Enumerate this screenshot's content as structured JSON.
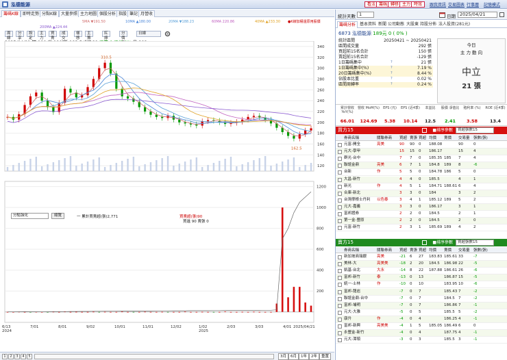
{
  "app": {
    "title": "泓德能源",
    "buttons": [
      "看法",
      "籌碼",
      "轉移",
      "主力",
      "時效"
    ],
    "links": [
      "跟我資訊",
      "交易圖表",
      "行事曆",
      "記憶模式"
    ]
  },
  "chart_tabs": [
    "籌碼K線",
    "即時走勢",
    "分點K線",
    "大量參照",
    "主力地圖",
    "個股分析",
    "指股",
    "筆記",
    "月營收"
  ],
  "ma_legend": [
    {
      "label": "5MA ▼191.50",
      "color": "#d06a6a"
    },
    {
      "label": "10MA ▲180.00",
      "color": "#4a86d9"
    },
    {
      "label": "20MA ▼188.23",
      "color": "#5aa0d8"
    },
    {
      "label": "60MA 220.86",
      "color": "#c060c0"
    },
    {
      "label": "40MA ▲233.30",
      "color": "#e0a020"
    },
    {
      "label": "200MA ▲224.44",
      "color": "#8a5ad0"
    }
  ],
  "ma_toggle": "●K線加權還原用股價",
  "toolbar": [
    "周線",
    "分享",
    "設定",
    "主力",
    "買賣",
    "成交量",
    "樣態",
    "主籌碼",
    "紅綠燈",
    "分價量",
    "日線"
  ],
  "info": {
    "date": "2025/04/21",
    "open": "開 190",
    "high": "高 190",
    "low": "低 183.5",
    "close": "收 189",
    "change": "漲跌 0",
    "pct": "漲幅 0%",
    "vol": "量 292"
  },
  "chart_data": {
    "type": "candlestick",
    "price_ticks": [
      "340",
      "320",
      "300",
      "280",
      "260",
      "240",
      "220",
      "200",
      "180",
      "160",
      "140",
      "120"
    ],
    "peak_label": "310.5",
    "low_label": "162.5",
    "x_ticks": [
      "6/13\n2024",
      "7/01",
      "8/01",
      "9/02",
      "10/01",
      "11/01",
      "12/02",
      "1/02\n2025",
      "2/03",
      "3/03",
      "4/01",
      "2025/04/21"
    ],
    "vol_ticks": [
      "1200",
      "1000",
      "800",
      "600",
      "400",
      "200"
    ],
    "vol_legend": [
      "一 累計買賣超(張)2,771",
      "買賣超(張)90",
      "買進 90 賣張 0"
    ],
    "close_series": [
      210,
      205,
      215,
      232,
      248,
      255,
      240,
      228,
      219,
      236,
      262,
      255,
      246,
      250,
      265,
      280,
      300,
      310,
      290,
      262,
      248,
      244,
      238,
      228,
      220,
      214,
      210,
      208,
      212,
      205,
      200,
      198,
      196,
      194,
      202,
      204,
      203,
      200,
      197,
      199,
      201,
      205,
      210,
      212,
      209,
      205,
      198,
      190,
      182,
      175,
      170,
      178,
      185,
      189
    ],
    "net_buy_series": [
      0,
      0,
      2,
      0,
      -3,
      1,
      0,
      -1,
      2,
      0,
      3,
      0,
      1,
      0,
      0,
      2,
      -2,
      1,
      0,
      0,
      3,
      0,
      -1,
      0,
      2,
      0,
      0,
      1,
      -2,
      0,
      0,
      3,
      0,
      0,
      1,
      0,
      -2,
      0,
      4,
      0,
      0,
      1,
      0,
      2,
      0,
      0,
      0,
      80,
      1000,
      140,
      240,
      240,
      90,
      60
    ],
    "cumulative_series": [
      0,
      0,
      1,
      2,
      1,
      1,
      0,
      1,
      2,
      2,
      3,
      4,
      4,
      5,
      5,
      6,
      6,
      7,
      7,
      7,
      8,
      8,
      8,
      9,
      9,
      9,
      10,
      10,
      10,
      11,
      11,
      11,
      12,
      12,
      12,
      12,
      13,
      13,
      14,
      14,
      14,
      15,
      15,
      15,
      15,
      16,
      16,
      20,
      700,
      800,
      950,
      1050,
      1100,
      1150
    ]
  },
  "vol_panel": {
    "select": "分點強化",
    "button": "總覽"
  },
  "bottom": {
    "pages": [
      "1",
      "2",
      "3",
      "4",
      "5"
    ],
    "zoom": [
      "3月",
      "6月",
      "1年",
      "2年",
      "3年"
    ],
    "reset": "重置"
  },
  "right": {
    "days_label": "統計天數",
    "days_value": "1",
    "date_label": "日期",
    "date_value": "2025/04/21",
    "tabs": [
      "籌碼分析",
      "基本資料",
      "新聞",
      "公司動態",
      "大股東",
      "持股分佈",
      "法人投資(281元)"
    ],
    "stock": "6873 泓德能源",
    "price": "189元 0 ( 0% )",
    "stats": [
      {
        "k": "統計區間",
        "v": "20250421 ~ 20250421"
      },
      {
        "k": "區間成交量",
        "v": "292 張"
      },
      {
        "k": "買超前15名合計",
        "v": "150 張"
      },
      {
        "k": "賣超前15名合計",
        "v": "-129 張"
      },
      {
        "k": "1日籌碼集中",
        "v": "21 張"
      },
      {
        "k": "1日籌碼集中(%)",
        "v": "7.19 %"
      },
      {
        "k": "20日籌碼集中(%)",
        "v": "8.44 %"
      },
      {
        "k": "佔股本比重",
        "v": "0.02 %"
      },
      {
        "k": "區間周轉率",
        "v": "0.24 %"
      }
    ],
    "today": {
      "t1": "今日",
      "t2": "主 力 動 向",
      "t3": "中立",
      "t4": "21 張"
    },
    "fin": [
      {
        "c": "累計營收\nYoY(%)",
        "v": "66.01"
      },
      {
        "c": "營收\nMoM(%)",
        "v": "124.69"
      },
      {
        "c": "EPS\n(元)",
        "v": "5.38"
      },
      {
        "c": "EPS\n(近4季)",
        "v": "10.14"
      },
      {
        "c": "本益比",
        "v": "12.5"
      },
      {
        "c": "股價\n淨值比",
        "v": "2.41"
      },
      {
        "c": "殖利率\n(%)",
        "v": "3.58"
      },
      {
        "c": "ROE\n(近4季)",
        "v": "13.4"
      }
    ],
    "buy_title": "買方15",
    "sell_title": "賣方15",
    "select_label": "■排序參數",
    "select_value": "買超張數15",
    "cols": [
      "券商名稱",
      "關聯券商",
      "買超",
      "賣張",
      "買超",
      "均價",
      "賣價",
      "交易量",
      "張數(張)"
    ],
    "buy_rows": [
      [
        "元富-開全",
        "亮美",
        "90",
        "90",
        "0",
        "188.08",
        "",
        "90",
        "0"
      ],
      [
        "元大-學甲",
        "",
        "15",
        "15",
        "0",
        "186.17",
        "",
        "15",
        "4"
      ],
      [
        "群光-台中",
        "",
        "7",
        "7",
        "0",
        "185.35",
        "185",
        "7",
        "4"
      ],
      [
        "聯誼金鼎",
        "亮美",
        "6",
        "7",
        "1",
        "184.8",
        "189",
        "8",
        "-6"
      ],
      [
        "台新",
        "作",
        "5",
        "5",
        "0",
        "184.78",
        "186",
        "5",
        "0"
      ],
      [
        "大昌-新竹",
        "",
        "4",
        "4",
        "0",
        "185.5",
        "",
        "4",
        "1"
      ],
      [
        "新光",
        "作",
        "4",
        "5",
        "1",
        "184.71",
        "188.61",
        "6",
        "4"
      ],
      [
        "合庫-新北",
        "",
        "3",
        "3",
        "0",
        "184",
        "",
        "3",
        "2"
      ],
      [
        "台灣摩根士丹利",
        "以色泰",
        "3",
        "4",
        "1",
        "185.12",
        "189",
        "5",
        "2"
      ],
      [
        "元大-嘉義",
        "",
        "3",
        "3",
        "0",
        "186.17",
        "",
        "3",
        "1"
      ],
      [
        "富邦證券",
        "",
        "2",
        "2",
        "0",
        "184.5",
        "",
        "2",
        "1"
      ],
      [
        "第一金-豐原",
        "",
        "2",
        "2",
        "0",
        "184.5",
        "",
        "2",
        "0"
      ],
      [
        "元富-新竹",
        "",
        "2",
        "3",
        "1",
        "185.69",
        "189",
        "4",
        "2"
      ]
    ],
    "sell_rows": [
      [
        "新加坡商瑞銀",
        "亮美",
        "-21",
        "6",
        "27",
        "183.83",
        "185.61",
        "33",
        "-7"
      ],
      [
        "美林-大",
        "亮美美",
        "-18",
        "2",
        "20",
        "184.5",
        "186.98",
        "22",
        "-5"
      ],
      [
        "凱基-台北",
        "大永",
        "-14",
        "8",
        "22",
        "187.88",
        "186.61",
        "26",
        "-6"
      ],
      [
        "富邦-新竹",
        "泰",
        "-13",
        "0",
        "13",
        "",
        "186.87",
        "15",
        "-5"
      ],
      [
        "統一-士林",
        "作",
        "-10",
        "0",
        "10",
        "",
        "183.95",
        "10",
        "-6"
      ],
      [
        "富邦-龍岩",
        "",
        "-7",
        "0",
        "7",
        "",
        "185.43",
        "7",
        "-2"
      ],
      [
        "聯誼金鼎-台中",
        "",
        "-7",
        "0",
        "7",
        "",
        "184.5",
        "7",
        "-2"
      ],
      [
        "富邦-埔明",
        "",
        "-7",
        "0",
        "7",
        "",
        "186.86",
        "7",
        "-1"
      ],
      [
        "元大-大雅",
        "",
        "-5",
        "0",
        "5",
        "",
        "185.5",
        "5",
        "-2"
      ],
      [
        "康升",
        "作",
        "-4",
        "0",
        "4",
        "",
        "186.25",
        "4",
        "-1"
      ],
      [
        "富邦-新興",
        "亮美美",
        "-4",
        "1",
        "5",
        "185.05",
        "186.49",
        "6",
        "0"
      ],
      [
        "永豐金-新竹",
        "",
        "-4",
        "0",
        "4",
        "",
        "187.75",
        "4",
        "-1"
      ],
      [
        "元大-潭頭",
        "",
        "-3",
        "0",
        "3",
        "",
        "185.5",
        "3",
        "-1"
      ]
    ]
  },
  "colors": {
    "up": "#d00000",
    "down": "#009900",
    "buy_bar": "#d61010",
    "sell_bar": "#1f8a1f",
    "accent": "#1a3e8a"
  }
}
